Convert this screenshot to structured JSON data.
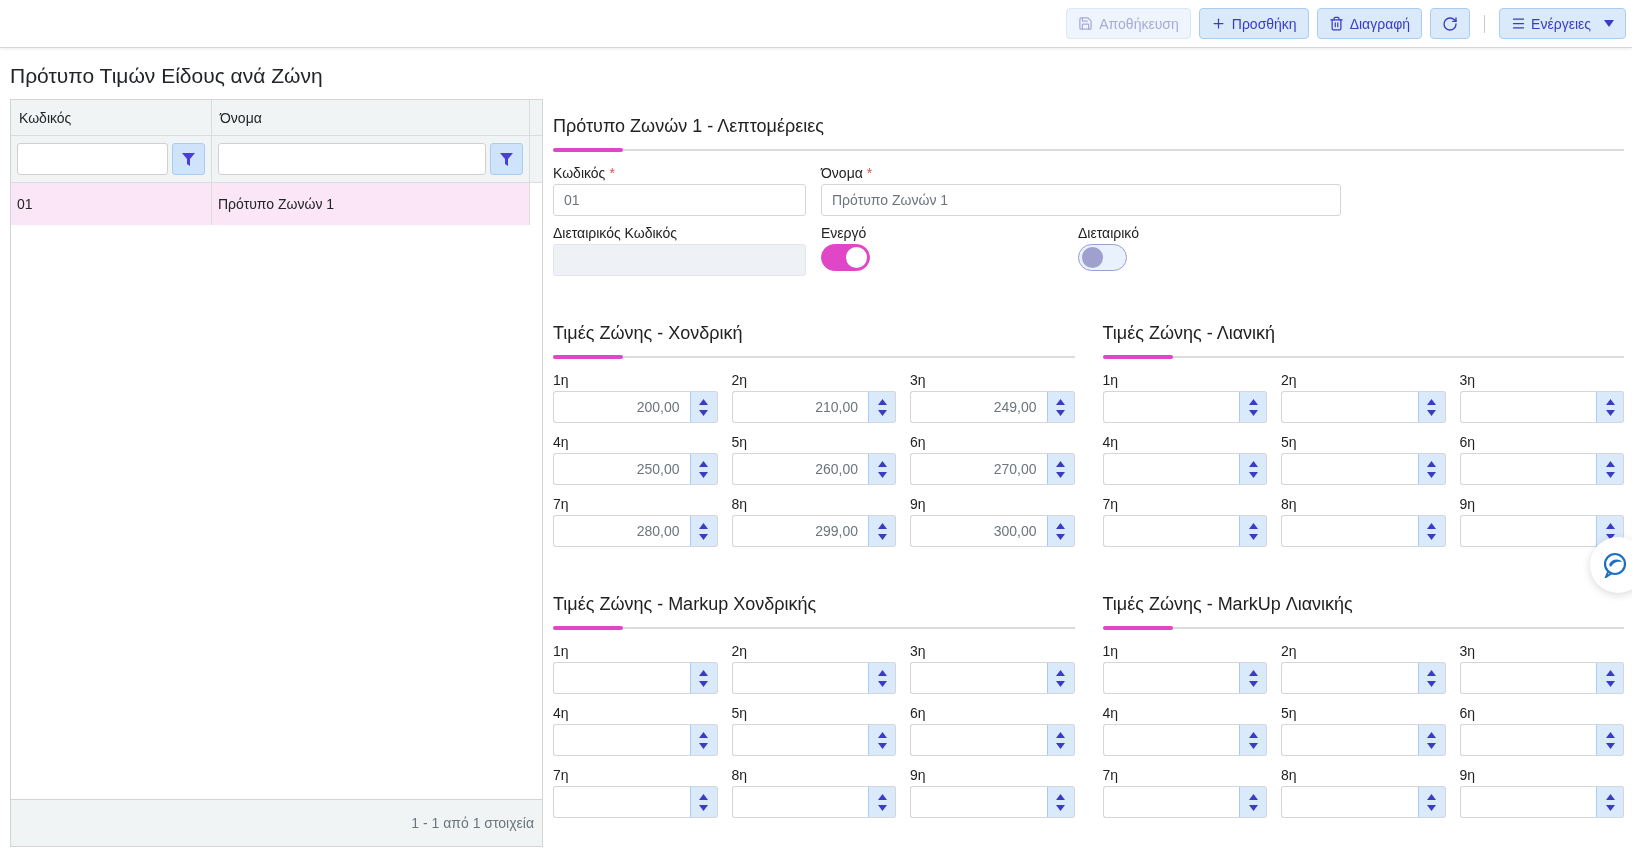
{
  "toolbar": {
    "buttons": [
      {
        "kind": "save",
        "label": "Αποθήκευση",
        "disabled": true
      },
      {
        "kind": "add",
        "label": "Προσθήκη",
        "disabled": false
      },
      {
        "kind": "delete",
        "label": "Διαγραφή",
        "disabled": false
      },
      {
        "kind": "refresh",
        "disabled": false
      }
    ],
    "actions_menu": {
      "label": "Ενέργειες"
    }
  },
  "page_title": "Πρότυπο Τιμών Είδους ανά Ζώνη",
  "grid": {
    "columns": [
      "Κωδικός",
      "Όνομα"
    ],
    "rows": [
      {
        "cells": [
          "01",
          "Πρότυπο Ζωνών 1"
        ],
        "selected": true
      }
    ],
    "footer": "1 - 1 από 1 στοιχεία"
  },
  "details": {
    "title": "Πρότυπο Ζωνών 1 - Λεπτομέρειες",
    "fields": [
      {
        "label": "Κωδικός",
        "required_mark": "*",
        "value": "01",
        "disabled": false
      },
      {
        "label": "Όνομα",
        "required_mark": "*",
        "value": "Πρότυπο Ζωνών 1",
        "disabled": false
      },
      {
        "label": "Διεταιρικός Κωδικός",
        "disabled": true
      }
    ],
    "toggles": [
      {
        "label": "Ενεργό",
        "on": true
      },
      {
        "label": "Διεταιρικό",
        "on": false
      }
    ]
  },
  "zone_sections": [
    {
      "title": "Τιμές Ζώνης - Χονδρική",
      "fields": [
        {
          "label": "1η",
          "value": "200,00"
        },
        {
          "label": "2η",
          "value": "210,00"
        },
        {
          "label": "3η",
          "value": "249,00"
        },
        {
          "label": "4η",
          "value": "250,00"
        },
        {
          "label": "5η",
          "value": "260,00"
        },
        {
          "label": "6η",
          "value": "270,00"
        },
        {
          "label": "7η",
          "value": "280,00"
        },
        {
          "label": "8η",
          "value": "299,00"
        },
        {
          "label": "9η",
          "value": "300,00"
        }
      ]
    },
    {
      "title": "Τιμές Ζώνης - Λιανική",
      "fields": [
        {
          "label": "1η"
        },
        {
          "label": "2η"
        },
        {
          "label": "3η"
        },
        {
          "label": "4η"
        },
        {
          "label": "5η"
        },
        {
          "label": "6η"
        },
        {
          "label": "7η"
        },
        {
          "label": "8η"
        },
        {
          "label": "9η"
        }
      ]
    },
    {
      "title": "Τιμές Ζώνης - Markup Χονδρικής",
      "fields": [
        {
          "label": "1η"
        },
        {
          "label": "2η"
        },
        {
          "label": "3η"
        },
        {
          "label": "4η"
        },
        {
          "label": "5η"
        },
        {
          "label": "6η"
        },
        {
          "label": "7η"
        },
        {
          "label": "8η"
        },
        {
          "label": "9η"
        }
      ]
    },
    {
      "title": "Τιμές Ζώνης - MarkUp Λιανικής",
      "fields": [
        {
          "label": "1η"
        },
        {
          "label": "2η"
        },
        {
          "label": "3η"
        },
        {
          "label": "4η"
        },
        {
          "label": "5η"
        },
        {
          "label": "6η"
        },
        {
          "label": "7η"
        },
        {
          "label": "8η"
        },
        {
          "label": "9η"
        }
      ]
    }
  ]
}
